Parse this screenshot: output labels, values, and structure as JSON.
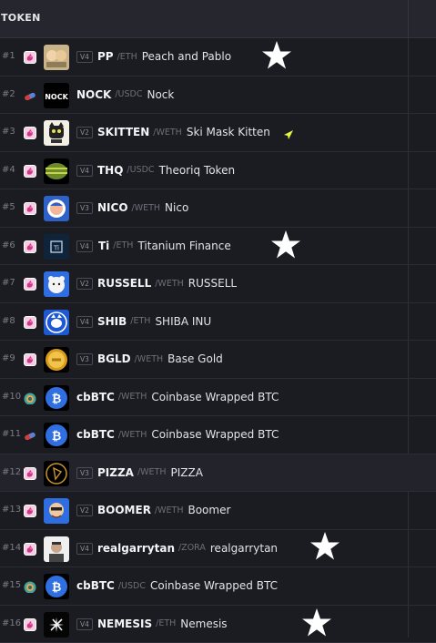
{
  "header": {
    "title": "TOKEN"
  },
  "rows": [
    {
      "rank": "#1",
      "dex": "uniswap",
      "version": "V4",
      "symbol": "PP",
      "pair": "/ETH",
      "name": "Peach and Pablo",
      "starred": true
    },
    {
      "rank": "#2",
      "dex": "pumpswap",
      "version": "",
      "symbol": "NOCK",
      "pair": "/USDC",
      "name": "Nock",
      "starred": false
    },
    {
      "rank": "#3",
      "dex": "uniswap",
      "version": "V2",
      "symbol": "SKITTEN",
      "pair": "/WETH",
      "name": "Ski Mask Kitten",
      "starred": false,
      "boosted": true
    },
    {
      "rank": "#4",
      "dex": "uniswap",
      "version": "V4",
      "symbol": "THQ",
      "pair": "/USDC",
      "name": "Theoriq Token",
      "starred": false
    },
    {
      "rank": "#5",
      "dex": "uniswap",
      "version": "V3",
      "symbol": "NICO",
      "pair": "/WETH",
      "name": "Nico",
      "starred": false
    },
    {
      "rank": "#6",
      "dex": "uniswap",
      "version": "V4",
      "symbol": "Ti",
      "pair": "/ETH",
      "name": "Titanium Finance",
      "starred": true
    },
    {
      "rank": "#7",
      "dex": "uniswap",
      "version": "V2",
      "symbol": "RUSSELL",
      "pair": "/WETH",
      "name": "RUSSELL",
      "starred": false
    },
    {
      "rank": "#8",
      "dex": "uniswap",
      "version": "V4",
      "symbol": "SHIB",
      "pair": "/ETH",
      "name": "SHIBA INU",
      "starred": false
    },
    {
      "rank": "#9",
      "dex": "uniswap",
      "version": "V3",
      "symbol": "BGLD",
      "pair": "/WETH",
      "name": "Base Gold",
      "starred": false
    },
    {
      "rank": "#10",
      "dex": "aerodrome",
      "version": "",
      "symbol": "cbBTC",
      "pair": "/WETH",
      "name": "Coinbase Wrapped BTC",
      "starred": false
    },
    {
      "rank": "#11",
      "dex": "pumpswap",
      "version": "",
      "symbol": "cbBTC",
      "pair": "/WETH",
      "name": "Coinbase Wrapped BTC",
      "starred": false
    },
    {
      "rank": "#12",
      "dex": "uniswap",
      "version": "V3",
      "symbol": "PIZZA",
      "pair": "/WETH",
      "name": "PIZZA",
      "starred": false,
      "highlight": true
    },
    {
      "rank": "#13",
      "dex": "uniswap",
      "version": "V2",
      "symbol": "BOOMER",
      "pair": "/WETH",
      "name": "Boomer",
      "starred": false
    },
    {
      "rank": "#14",
      "dex": "uniswap",
      "version": "V4",
      "symbol": "realgarrytan",
      "pair": "/ZORA",
      "name": "realgarrytan",
      "starred": true
    },
    {
      "rank": "#15",
      "dex": "aerodrome",
      "version": "",
      "symbol": "cbBTC",
      "pair": "/USDC",
      "name": "Coinbase Wrapped BTC",
      "starred": false
    },
    {
      "rank": "#16",
      "dex": "uniswap",
      "version": "V4",
      "symbol": "NEMESIS",
      "pair": "/ETH",
      "name": "Nemesis",
      "starred": true
    }
  ],
  "colors": {
    "background": "#1b1c22",
    "header": "#26272e",
    "uniswap": "#f4cfe2",
    "star": "#ffffff",
    "boost": "#e6f542"
  }
}
